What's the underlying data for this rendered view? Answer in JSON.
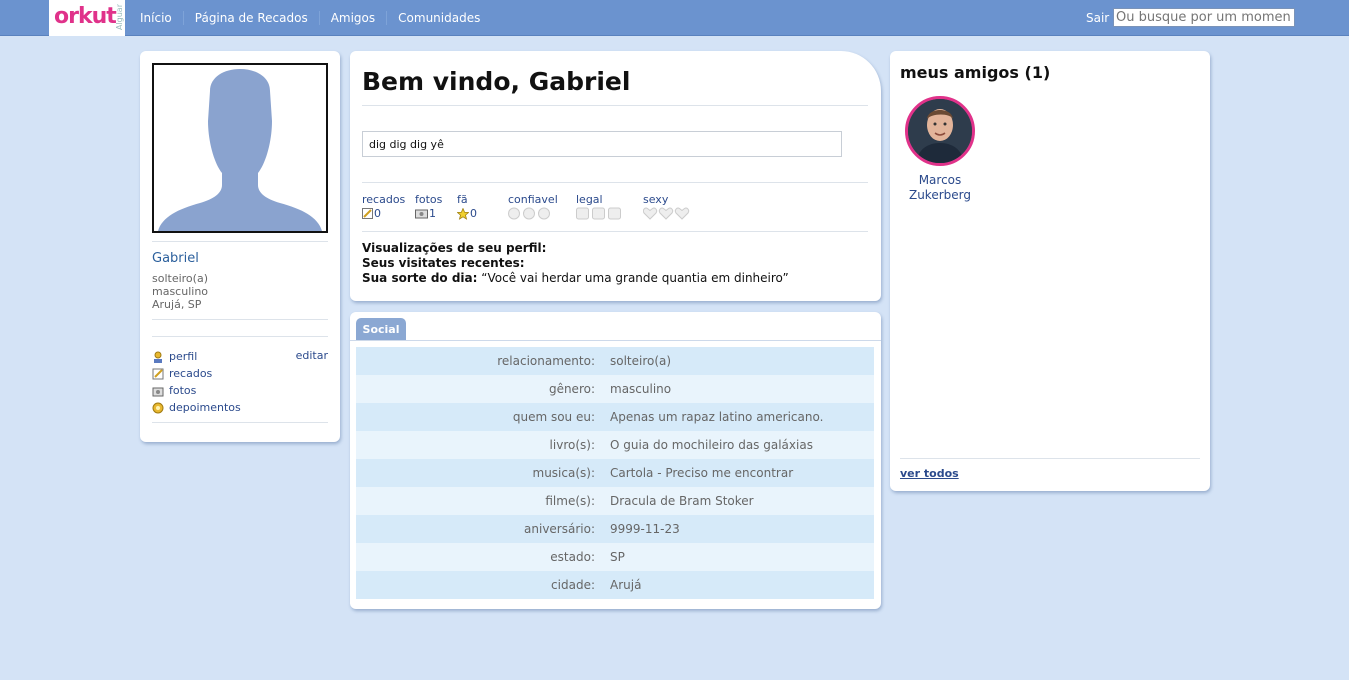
{
  "topbar": {
    "logo": "orkut",
    "logo_sub": "Alguar",
    "nav": [
      "Início",
      "Página de Recados",
      "Amigos",
      "Comunidades"
    ],
    "logout": "Sair",
    "search_placeholder": "Ou busque por um momen"
  },
  "profile": {
    "name": "Gabriel",
    "info": [
      "solteiro(a)",
      "masculino",
      "Arujá, SP"
    ],
    "menu": [
      {
        "label": "perfil",
        "icon": "profile-icon"
      },
      {
        "label": "recados",
        "icon": "scrap-icon"
      },
      {
        "label": "fotos",
        "icon": "camera-icon"
      },
      {
        "label": "depoimentos",
        "icon": "testimonial-icon"
      }
    ],
    "edit": "editar"
  },
  "welcome": {
    "title": "Bem vindo, Gabriel",
    "status": "dig dig dig yê",
    "stats": {
      "recados": {
        "label": "recados",
        "value": "0"
      },
      "fotos": {
        "label": "fotos",
        "value": "1"
      },
      "fa": {
        "label": "fã",
        "value": "0"
      },
      "confiavel": {
        "label": "confiavel"
      },
      "legal": {
        "label": "legal"
      },
      "sexy": {
        "label": "sexy"
      }
    },
    "views_label": "Visualizações de seu perfil:",
    "visitors_label": "Seus visitates recentes:",
    "luck_label": "Sua sorte do dia:",
    "luck_text": "“Você vai herdar uma grande quantia em dinheiro”"
  },
  "social": {
    "tab": "Social",
    "rows": [
      {
        "k": "relacionamento:",
        "v": "solteiro(a)"
      },
      {
        "k": "gênero:",
        "v": "masculino"
      },
      {
        "k": "quem sou eu:",
        "v": "Apenas um rapaz latino americano."
      },
      {
        "k": "livro(s):",
        "v": "O guia do mochileiro das galáxias"
      },
      {
        "k": "musica(s):",
        "v": "Cartola - Preciso me encontrar"
      },
      {
        "k": "filme(s):",
        "v": "Dracula de Bram Stoker"
      },
      {
        "k": "aniversário:",
        "v": "9999-11-23"
      },
      {
        "k": "estado:",
        "v": "SP"
      },
      {
        "k": "cidade:",
        "v": "Arujá"
      }
    ]
  },
  "friends": {
    "title": "meus amigos (1)",
    "list": [
      {
        "name": "Marcos Zukerberg"
      }
    ],
    "see_all": "ver todos"
  },
  "colors": {
    "topbar": "#6b93cf",
    "background": "#d4e3f6",
    "brand_pink": "#e0328a",
    "link": "#2b4a8c"
  }
}
